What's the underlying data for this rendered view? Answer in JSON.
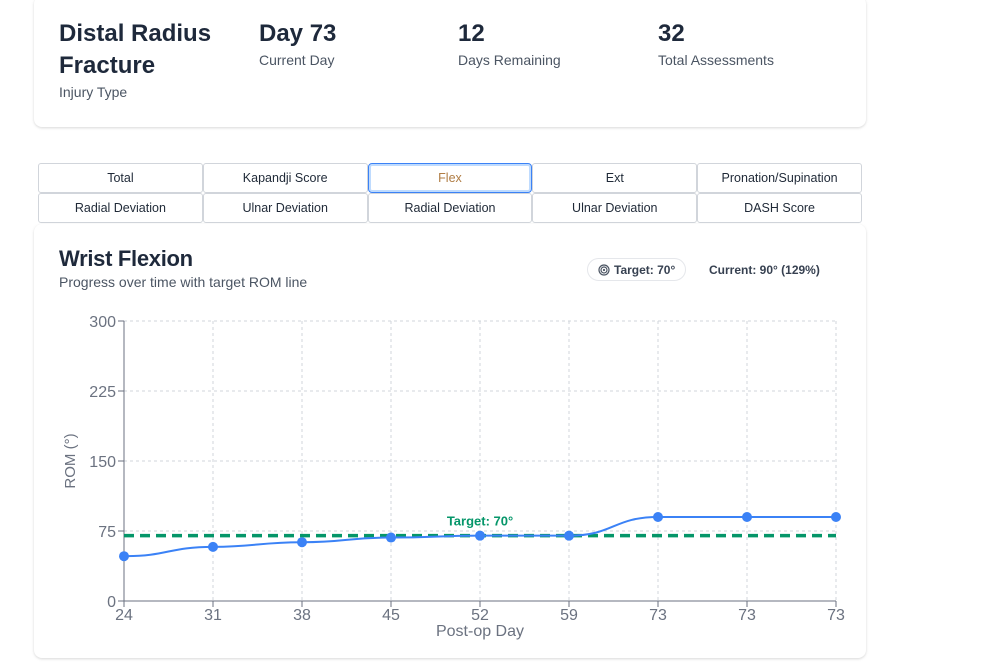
{
  "summary": {
    "injury_type": {
      "value": "Distal Radius Fracture",
      "label": "Injury Type"
    },
    "current_day": {
      "value": "Day 73",
      "label": "Current Day"
    },
    "days_remaining": {
      "value": "12",
      "label": "Days Remaining"
    },
    "total_assessments": {
      "value": "32",
      "label": "Total Assessments"
    }
  },
  "tabs": {
    "row1": [
      "Total",
      "Kapandji Score",
      "Flex",
      "Ext",
      "Pronation/Supination"
    ],
    "row2": [
      "Radial Deviation",
      "Ulnar Deviation",
      "Radial Deviation",
      "Ulnar Deviation",
      "DASH Score"
    ],
    "active": "Flex"
  },
  "chart_panel": {
    "title": "Wrist Flexion",
    "subtitle": "Progress over time with target ROM line",
    "target_badge": "Target: 70°",
    "current_text": "Current: 90° (129%)"
  },
  "colors": {
    "line": "#3b82f6",
    "target": "#059669",
    "active_tab_text": "#b07d45",
    "grid": "#d1d5db"
  },
  "chart_data": {
    "type": "line",
    "title": "Wrist Flexion",
    "subtitle": "Progress over time with target ROM line",
    "xlabel": "Post-op Day",
    "ylabel": "ROM (°)",
    "categories": [
      "24",
      "31",
      "38",
      "45",
      "52",
      "59",
      "73",
      "73",
      "73"
    ],
    "series": [
      {
        "values": [
          48,
          58,
          63,
          68,
          70,
          70,
          90,
          90,
          90
        ]
      }
    ],
    "target": {
      "value": 70,
      "label": "Target: 70°"
    },
    "yticks": [
      0,
      75,
      150,
      225,
      300
    ],
    "ylim": [
      0,
      300
    ],
    "grid": true,
    "legend": "none"
  }
}
